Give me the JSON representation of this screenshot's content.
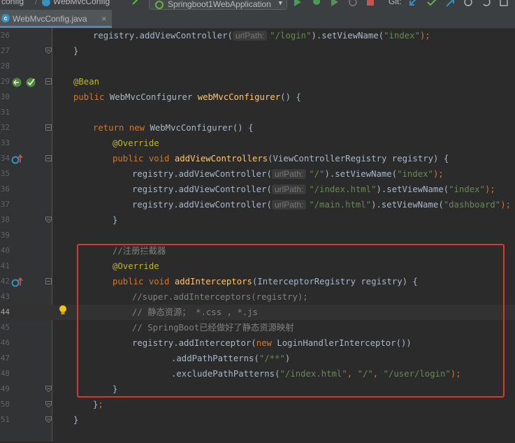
{
  "toolbar": {
    "breadcrumb_project": "config",
    "breadcrumb_sep": "/",
    "breadcrumb_file": "WebMvcConfig",
    "run_config": "Springboot1WebApplication",
    "vcs_label": "Git:"
  },
  "tab": {
    "name": "WebMvcConfig.java",
    "close": "×"
  },
  "line_numbers": [
    "26",
    "27",
    "28",
    "29",
    "30",
    "31",
    "32",
    "33",
    "34",
    "35",
    "36",
    "37",
    "38",
    "39",
    "40",
    "41",
    "42",
    "43",
    "44",
    "45",
    "46",
    "47",
    "48",
    "49",
    "50",
    "51"
  ],
  "code": {
    "l26_recv": "registry.addViewController(",
    "l26_hint": "urlPath:",
    "l26_str": "\"/login\"",
    "l26_mid": ").setViewName(",
    "l26_str2": "\"index\"",
    "l26_end": ");",
    "l27": "}",
    "l29_ann": "@Bean",
    "l30_kw": "public",
    "l30_type": "WebMvcConfigurer",
    "l30_fn": "webMvcConfigurer",
    "l30_end": "() {",
    "l32_kw1": "return",
    "l32_kw2": "new",
    "l32_type": "WebMvcConfigurer() {",
    "l33_ann": "@Override",
    "l34_kw1": "public",
    "l34_kw2": "void",
    "l34_fn": "addViewControllers",
    "l34_args": "(ViewControllerRegistry registry) {",
    "l35_recv": "registry.addViewController(",
    "l35_hint": "urlPath:",
    "l35_str": "\"/\"",
    "l35_mid": ").setViewName(",
    "l35_str2": "\"index\"",
    "l35_end": ");",
    "l36_recv": "registry.addViewController(",
    "l36_hint": "urlPath:",
    "l36_str": "\"/index.html\"",
    "l36_mid": ").setViewName(",
    "l36_str2": "\"index\"",
    "l36_end": ");",
    "l37_recv": "registry.addViewController(",
    "l37_hint": "urlPath:",
    "l37_str": "\"/main.html\"",
    "l37_mid": ").setViewName(",
    "l37_str2": "\"dashboard\"",
    "l37_end": ");",
    "l38": "}",
    "l40_cmt": "//注册拦截器",
    "l41_ann": "@Override",
    "l42_kw1": "public",
    "l42_kw2": "void",
    "l42_fn": "addInterceptors",
    "l42_args": "(InterceptorRegistry registry) {",
    "l43_cmt": "//super.addInterceptors(registry);",
    "l44_cmt": "// 静态资源； *.css , *.js",
    "l45_cmt": "// SpringBoot已经做好了静态资源映射",
    "l46_recv": "registry.addInterceptor(",
    "l46_kw": "new",
    "l46_rest": "LoginHandlerInterceptor())",
    "l47_a": ".addPathPatterns(",
    "l47_str": "\"/**\"",
    "l47_end": ")",
    "l48_a": ".excludePathPatterns(",
    "l48_s1": "\"/index.html\"",
    "l48_c1": ", ",
    "l48_s2": "\"/\"",
    "l48_c2": ", ",
    "l48_s3": "\"/user/login\"",
    "l48_end": ");",
    "l49": "}",
    "l50_brace": "}",
    "l50_semi": ";",
    "l51": "}"
  },
  "colors": {
    "keyword": "#cc7832",
    "annotation": "#bbb529",
    "method": "#ffc66d",
    "string": "#6a8759",
    "comment": "#808080",
    "highlight_box": "#e0332b"
  }
}
